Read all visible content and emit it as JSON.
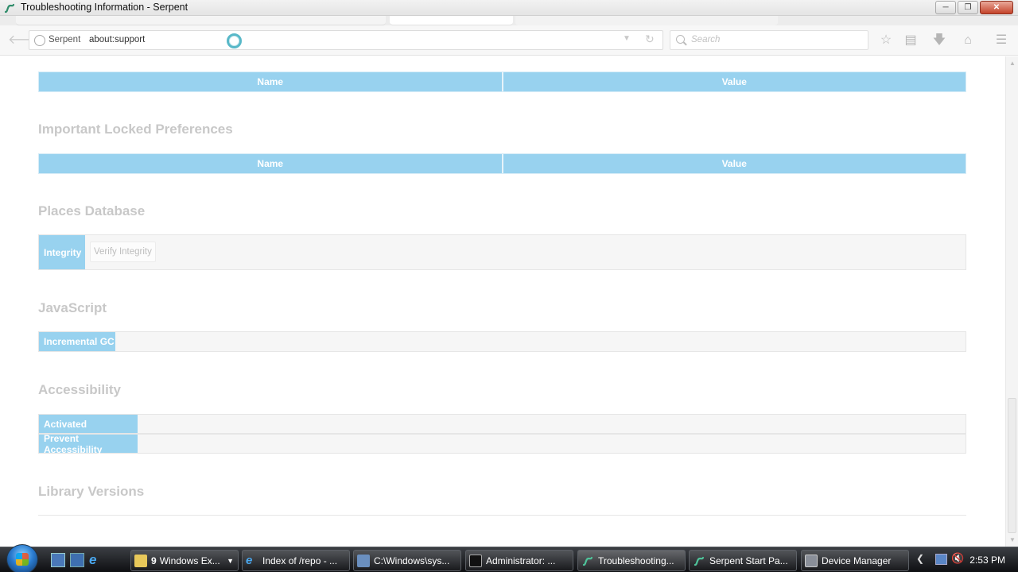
{
  "window": {
    "title": "Troubleshooting Information - Serpent",
    "controls": [
      "minimize",
      "maximize",
      "close"
    ]
  },
  "navbar": {
    "site_label": "Serpent",
    "url": "about:support",
    "search_placeholder": "Search",
    "icons": [
      "back-icon",
      "bookmark-star-icon",
      "reading-list-icon",
      "download-icon",
      "home-icon",
      "menu-icon"
    ]
  },
  "content": {
    "table_headers": {
      "name": "Name",
      "value": "Value"
    },
    "locked_prefs": {
      "title": "Important Locked Preferences"
    },
    "places_db": {
      "title": "Places Database",
      "integrity_label": "Integrity",
      "verify_button": "Verify Integrity"
    },
    "javascript": {
      "title": "JavaScript",
      "incremental_gc_label": "Incremental GC"
    },
    "accessibility": {
      "title": "Accessibility",
      "activated_label": "Activated",
      "prevent_label": "Prevent Accessibility"
    },
    "library_versions": {
      "title": "Library Versions"
    }
  },
  "taskbar": {
    "buttons": [
      {
        "label": "Windows Ex...",
        "count": "9",
        "icon": "folder-icon"
      },
      {
        "label": "Index of /repo - ...",
        "icon": "ie-icon"
      },
      {
        "label": "C:\\Windows\\sys...",
        "icon": "app-icon"
      },
      {
        "label": "Administrator: ...",
        "icon": "cmd-icon"
      },
      {
        "label": "Troubleshooting...",
        "icon": "serpent-icon"
      },
      {
        "label": "Serpent Start Pa...",
        "icon": "serpent-icon"
      },
      {
        "label": "Device Manager",
        "icon": "device-manager-icon"
      }
    ],
    "clock": "2:53 PM"
  }
}
